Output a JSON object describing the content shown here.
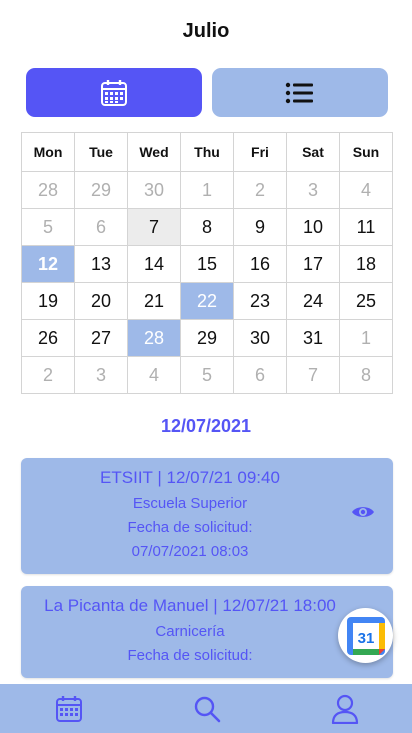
{
  "header": {
    "month": "Julio"
  },
  "view_toggle": {
    "calendar_icon": "calendar-icon",
    "list_icon": "list-icon"
  },
  "calendar": {
    "weekdays": [
      "Mon",
      "Tue",
      "Wed",
      "Thu",
      "Fri",
      "Sat",
      "Sun"
    ],
    "weeks": [
      [
        "28",
        "29",
        "30",
        "1",
        "2",
        "3",
        "4"
      ],
      [
        "5",
        "6",
        "7",
        "8",
        "9",
        "10",
        "11"
      ],
      [
        "12",
        "13",
        "14",
        "15",
        "16",
        "17",
        "18"
      ],
      [
        "19",
        "20",
        "21",
        "22",
        "23",
        "24",
        "25"
      ],
      [
        "26",
        "27",
        "28",
        "29",
        "30",
        "31",
        "1"
      ],
      [
        "2",
        "3",
        "4",
        "5",
        "6",
        "7",
        "8"
      ]
    ]
  },
  "selected_date": "12/07/2021",
  "appointments": [
    {
      "title": "ETSIIT | 12/07/21 09:40",
      "place": "Escuela Superior",
      "request_label": "Fecha de solicitud:",
      "request_date": "07/07/2021 08:03",
      "action_icon": "eye-icon"
    },
    {
      "title": "La Picanta de Manuel | 12/07/21 18:00",
      "place": "Carnicería",
      "request_label": "Fecha de solicitud:"
    }
  ],
  "fab": {
    "icon": "google-calendar-icon",
    "label": "31"
  },
  "bottom_nav": {
    "items": [
      "calendar-icon",
      "search-icon",
      "user-icon"
    ]
  },
  "colors": {
    "accent": "#5555f5",
    "light_accent": "#9eb9e8",
    "today_bg": "#ececec",
    "muted_text": "#b0b0b0"
  }
}
